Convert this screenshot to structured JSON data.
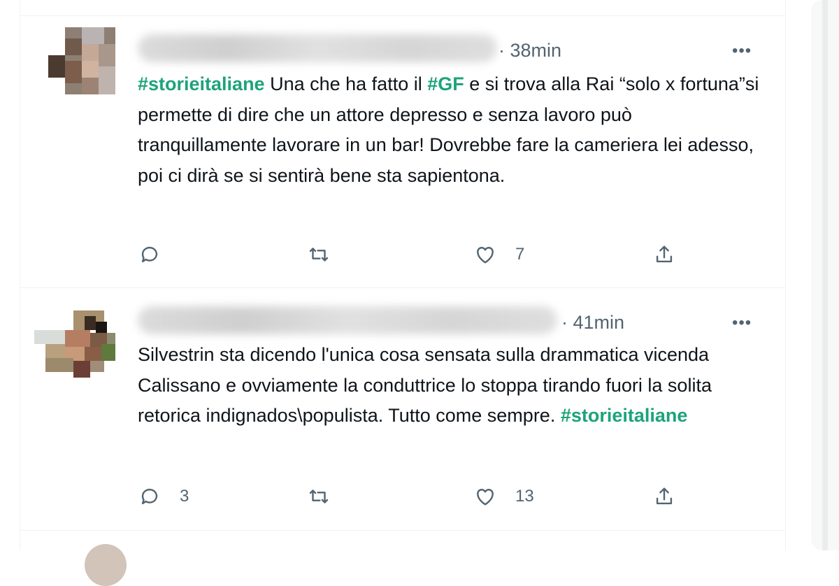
{
  "tweets": [
    {
      "time": "· 38min",
      "more": "•••",
      "segments": [
        {
          "text": "#storieitaliane",
          "hashtag": true
        },
        {
          "text": " Una che ha fatto il ",
          "hashtag": false
        },
        {
          "text": "#GF",
          "hashtag": true
        },
        {
          "text": " e si trova alla Rai “solo x fortuna”si permette di dire che un attore depresso e senza lavoro può tranquillamente lavorare in un bar! Dovrebbe fare la cameriera lei adesso, poi ci dirà se si sentirà bene sta sapientona.",
          "hashtag": false
        }
      ],
      "actions": {
        "reply_count": "",
        "retweet_count": "",
        "like_count": "7"
      }
    },
    {
      "time": "· 41min",
      "more": "•••",
      "segments": [
        {
          "text": "Silvestrin sta dicendo l'unica cosa sensata sulla drammatica vicenda Calissano e ovviamente la conduttrice lo stoppa tirando fuori la solita retorica indignados\\populista. Tutto come sempre. ",
          "hashtag": false
        },
        {
          "text": "#storieitaliane",
          "hashtag": true
        }
      ],
      "actions": {
        "reply_count": "3",
        "retweet_count": "",
        "like_count": "13"
      }
    }
  ],
  "colors": {
    "hashtag": "#1da37a",
    "secondary": "#536471",
    "divider": "#eff3f4"
  },
  "icons": [
    "reply-icon",
    "retweet-icon",
    "like-icon",
    "share-icon",
    "more-icon"
  ]
}
